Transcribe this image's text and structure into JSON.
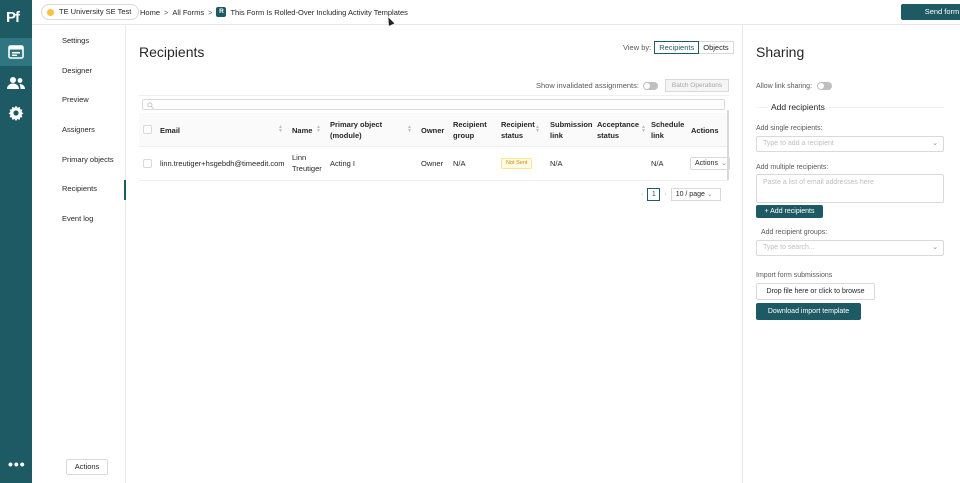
{
  "rail": {
    "logo": "Pf",
    "icons": [
      "forms-icon",
      "users-icon",
      "settings-icon"
    ],
    "more": "•••"
  },
  "topbar": {
    "org": "TE University SE Test",
    "breadcrumb": [
      "Home",
      "All Forms",
      "This Form Is Rolled-Over Including Activity Templates"
    ],
    "form_badge": "R",
    "send_button": "Send form"
  },
  "nav": {
    "items": [
      "Settings",
      "Designer",
      "Preview",
      "Assigners",
      "Primary objects",
      "Recipients",
      "Event log"
    ],
    "active": "Recipients",
    "actions_button": "Actions"
  },
  "main": {
    "title": "Recipients",
    "view_by_label": "View by:",
    "view_options": [
      "Recipients",
      "Objects"
    ],
    "view_selected": "Recipients",
    "show_invalidated_label": "Show invalidated assignments:",
    "batch_button": "Batch Operations",
    "columns": [
      "Email",
      "Name",
      "Primary object (module)",
      "Owner",
      "Recipient group",
      "Recipient status",
      "Submission link",
      "Acceptance status",
      "Schedule link",
      "Actions"
    ],
    "rows": [
      {
        "email": "linn.treutiger+hsgebdh@timeedit.com",
        "name": "Linn Treutiger",
        "primary_object": "Acting I",
        "owner": "Owner",
        "recipient_group": "N/A",
        "status": "Not Sent",
        "submission_link": "N/A",
        "acceptance_status": "",
        "schedule_link": "N/A",
        "actions": "Actions"
      }
    ],
    "pagination": {
      "current_page": "1",
      "page_size": "10 / page"
    }
  },
  "sharing": {
    "title": "Sharing",
    "allow_link_label": "Allow link sharing:",
    "add_recipients_heading": "Add recipients",
    "single_label": "Add single recipients:",
    "single_placeholder": "Type to add a recipient",
    "multiple_label": "Add multiple recipients:",
    "multiple_placeholder": "Paste a list of email addresses here",
    "add_button": "Add recipients",
    "groups_label": "Add recipient groups:",
    "groups_placeholder": "Type to search...",
    "import_label": "Import form submissions",
    "drop_button": "Drop file here or click to browse",
    "download_button": "Download import template"
  },
  "colors": {
    "brand": "#1e5a63",
    "status_pending": "#d48806",
    "org_dot": "#f6c33b"
  }
}
